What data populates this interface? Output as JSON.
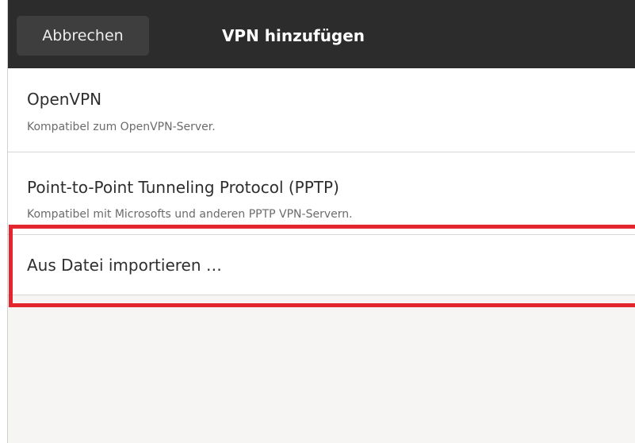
{
  "header": {
    "cancel_label": "Abbrechen",
    "title": "VPN hinzufügen"
  },
  "options": [
    {
      "title": "OpenVPN",
      "subtitle": "Kompatibel zum OpenVPN-Server."
    },
    {
      "title": "Point-to-Point Tunneling Protocol (PPTP)",
      "subtitle": "Kompatibel mit Microsofts und anderen PPTP VPN-Servern."
    },
    {
      "title": "Aus Datei importieren …"
    }
  ],
  "colors": {
    "titlebar": "#2c2c2c",
    "highlight": "#e3262e"
  }
}
